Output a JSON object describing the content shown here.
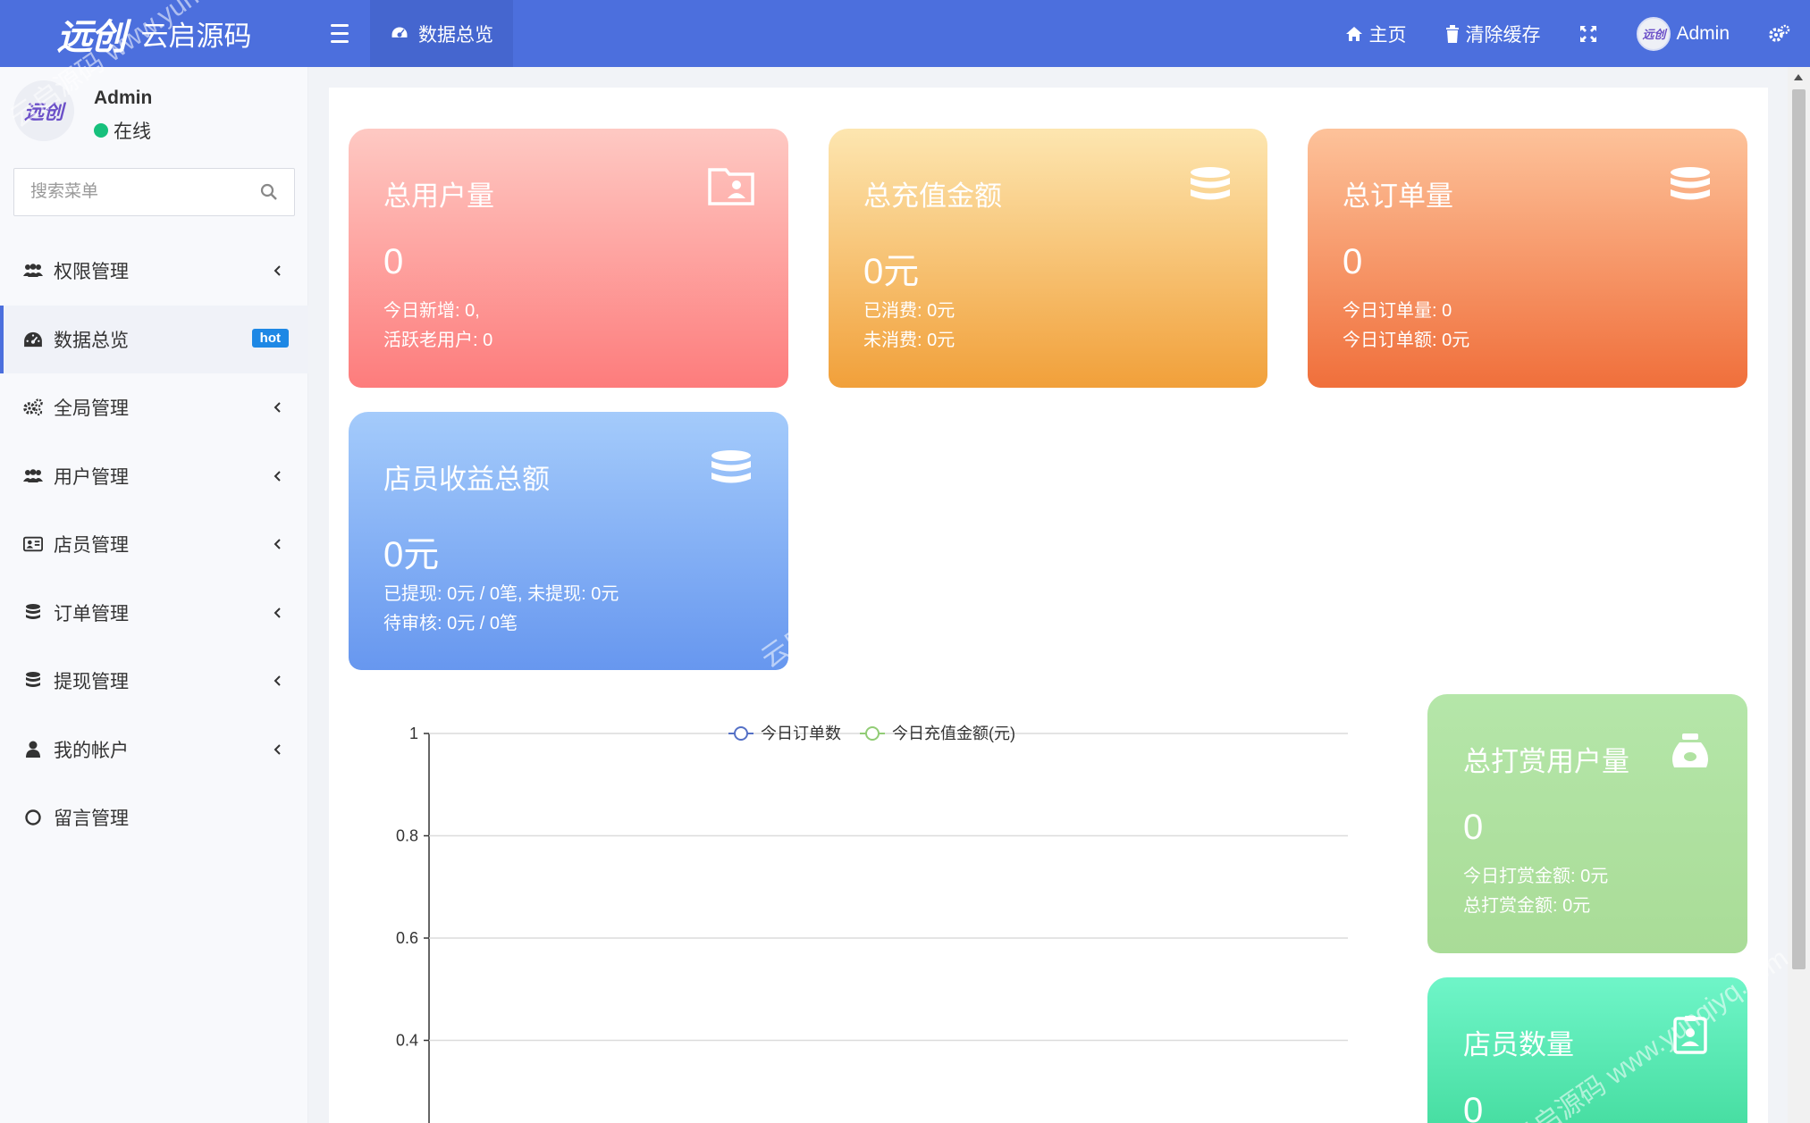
{
  "header": {
    "brand_text": "云启源码",
    "brand_mark": "远创",
    "active_tab": "数据总览",
    "home_label": "主页",
    "clear_cache_label": "清除缓存",
    "admin_label": "Admin",
    "avatar_mark": "远创"
  },
  "sidebar": {
    "user_name": "Admin",
    "user_status": "在线",
    "avatar_mark": "远创",
    "search_placeholder": "搜索菜单",
    "items": [
      {
        "label": "权限管理",
        "icon": "users-icon",
        "has_chevron": true
      },
      {
        "label": "数据总览",
        "icon": "dashboard-icon",
        "badge": "hot",
        "active": true
      },
      {
        "label": "全局管理",
        "icon": "cogs-icon",
        "has_chevron": true
      },
      {
        "label": "用户管理",
        "icon": "users-icon",
        "has_chevron": true
      },
      {
        "label": "店员管理",
        "icon": "id-card-icon",
        "has_chevron": true
      },
      {
        "label": "订单管理",
        "icon": "database-icon",
        "has_chevron": true
      },
      {
        "label": "提现管理",
        "icon": "database-icon",
        "has_chevron": true
      },
      {
        "label": "我的帐户",
        "icon": "user-icon",
        "has_chevron": true
      },
      {
        "label": "留言管理",
        "icon": "circle-icon"
      }
    ]
  },
  "cards": {
    "total_users": {
      "title": "总用户量",
      "value": "0",
      "line1": "今日新增: 0,",
      "line2": "活跃老用户: 0"
    },
    "total_recharge": {
      "title": "总充值金额",
      "value": "0元",
      "line1": "已消费: 0元",
      "line2": "未消费: 0元"
    },
    "total_orders": {
      "title": "总订单量",
      "value": "0",
      "line1": "今日订单量: 0",
      "line2": "今日订单额: 0元"
    },
    "clerk_income": {
      "title": "店员收益总额",
      "value": "0元",
      "line1": "已提现: 0元 / 0笔, 未提现: 0元",
      "line2": "待审核: 0元 / 0笔"
    },
    "tip_users": {
      "title": "总打赏用户量",
      "value": "0",
      "line1": "今日打赏金额: 0元",
      "line2": "总打赏金额: 0元"
    },
    "clerk_count": {
      "title": "店员数量",
      "value": "0"
    }
  },
  "chart_data": {
    "type": "line",
    "series": [
      {
        "name": "今日订单数",
        "values": [],
        "color": "#5470c6"
      },
      {
        "name": "今日充值金额(元)",
        "values": [],
        "color": "#91cc75"
      }
    ],
    "y_ticks": [
      "1",
      "0.8",
      "0.6",
      "0.4"
    ],
    "ylim": [
      0,
      1
    ],
    "grid": true,
    "legend": "top-center"
  },
  "colors": {
    "header_bg": "#4c6fdd",
    "accent": "#4c6fdd",
    "online": "#17c07c",
    "badge": "#1e88e5"
  },
  "watermark": "云启源码 www.yunqiyq.com"
}
